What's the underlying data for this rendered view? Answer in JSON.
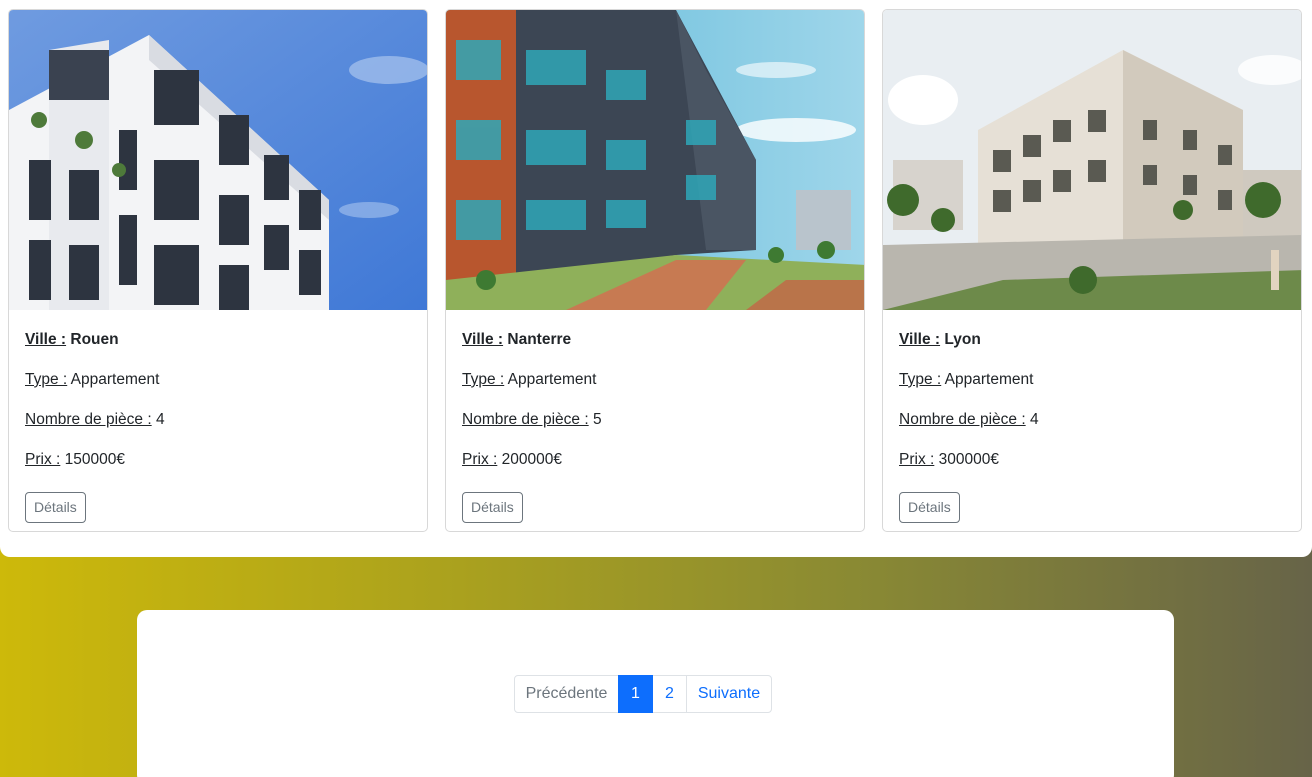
{
  "colors": {
    "accent": "#0d6efd",
    "muted": "#6c757d",
    "background_gradient_start": "#cdb90a",
    "background_gradient_end": "#676448"
  },
  "listings": [
    {
      "image": "building-photo-rouen",
      "city_label": "Ville :",
      "city": "Rouen",
      "type_label": "Type :",
      "type": "Appartement",
      "rooms_label": "Nombre de pièce :",
      "rooms": "4",
      "price_label": "Prix :",
      "price": "150000€",
      "details_label": "Détails"
    },
    {
      "image": "building-photo-nanterre",
      "city_label": "Ville :",
      "city": "Nanterre",
      "type_label": "Type :",
      "type": "Appartement",
      "rooms_label": "Nombre de pièce :",
      "rooms": "5",
      "price_label": "Prix :",
      "price": "200000€",
      "details_label": "Détails"
    },
    {
      "image": "building-photo-lyon",
      "city_label": "Ville :",
      "city": "Lyon",
      "type_label": "Type :",
      "type": "Appartement",
      "rooms_label": "Nombre de pièce :",
      "rooms": "4",
      "price_label": "Prix :",
      "price": "300000€",
      "details_label": "Détails"
    }
  ],
  "pagination": {
    "prev_label": "Précédente",
    "pages": [
      "1",
      "2"
    ],
    "active_page": "1",
    "next_label": "Suivante"
  }
}
